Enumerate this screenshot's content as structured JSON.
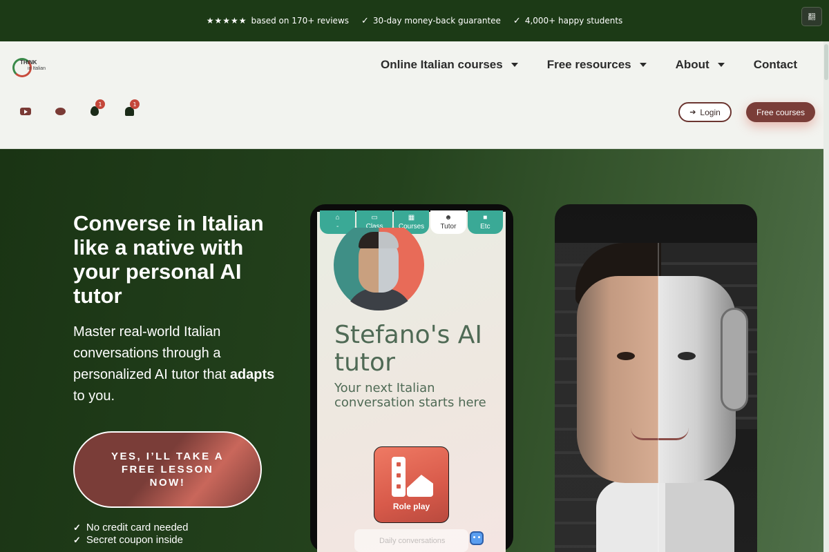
{
  "topbar": {
    "stars": "★★★★★",
    "reviews": "based on 170+ reviews",
    "guarantee": "30-day money-back guarantee",
    "students": "4,000+ happy students",
    "ext_icon": "翻"
  },
  "logo": {
    "line1": "THINK",
    "line2": "in Italian"
  },
  "nav": {
    "items": [
      {
        "label": "Online Italian courses",
        "has_dropdown": true
      },
      {
        "label": "Free resources",
        "has_dropdown": true
      },
      {
        "label": "About",
        "has_dropdown": true
      },
      {
        "label": "Contact",
        "has_dropdown": false
      }
    ]
  },
  "social": {
    "icons": [
      "youtube-icon",
      "reddit-icon",
      "fire-icon",
      "bell-icon"
    ],
    "badges": {
      "fire": "1",
      "bell": "1"
    }
  },
  "header_buttons": {
    "login": "Login",
    "free_courses": "Free courses"
  },
  "hero": {
    "title": "Converse in Italian like a native with your personal AI tutor",
    "subtitle_before": "Master real-world Italian conversations through a personalized AI tutor that ",
    "subtitle_bold": "adapts",
    "subtitle_after": " to you.",
    "cta": "YES, I’LL TAKE A FREE LESSON NOW!",
    "perks": [
      "No credit card needed",
      "Secret coupon inside"
    ]
  },
  "phone": {
    "tabs": [
      {
        "label": "-",
        "icon": "home-icon"
      },
      {
        "label": "Class",
        "icon": "class-icon"
      },
      {
        "label": "Courses",
        "icon": "grid-icon"
      },
      {
        "label": "Tutor",
        "icon": "robot-icon",
        "active": true
      },
      {
        "label": "Etc",
        "icon": "folder-icon"
      }
    ],
    "title": "Stefano's AI tutor",
    "subtitle": "Your next Italian conversation starts here",
    "roleplay": "Role play",
    "ghost_button": "Daily conversations"
  },
  "portrait": {
    "bg_lines": [
      "Ciao Stefano! Fam",
      "Hi Stefano! I",
      "E il tu",
      "Pizza",
      "La pizza",
      "Pizza sca",
      "Margh",
      "Pizza sca"
    ]
  },
  "colors": {
    "topbar_bg": "#1c3a16",
    "brand_maroon": "#7a3d38",
    "accent_teal": "#3aa996",
    "hero_green": "#24421d"
  }
}
